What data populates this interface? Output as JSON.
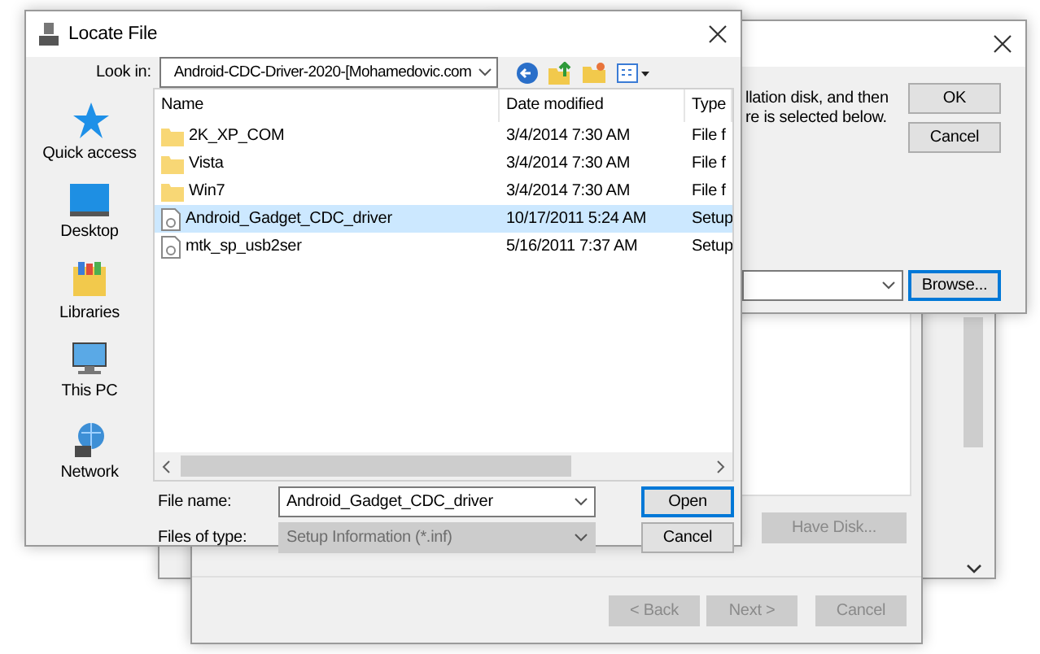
{
  "locate_dialog": {
    "title": "Locate File",
    "look_in_label": "Look in:",
    "look_in_value": "Android-CDC-Driver-2020-[Mohamedovic.com",
    "places": [
      {
        "label": "Quick access",
        "kind": "star"
      },
      {
        "label": "Desktop",
        "kind": "desktop"
      },
      {
        "label": "Libraries",
        "kind": "libraries"
      },
      {
        "label": "This PC",
        "kind": "pc"
      },
      {
        "label": "Network",
        "kind": "network"
      }
    ],
    "columns": [
      "Name",
      "Date modified",
      "Type"
    ],
    "rows": [
      {
        "name": "2K_XP_COM",
        "date": "3/4/2014 7:30 AM",
        "type": "File f",
        "kind": "folder",
        "selected": false
      },
      {
        "name": "Vista",
        "date": "3/4/2014 7:30 AM",
        "type": "File f",
        "kind": "folder",
        "selected": false
      },
      {
        "name": "Win7",
        "date": "3/4/2014 7:30 AM",
        "type": "File f",
        "kind": "folder",
        "selected": false
      },
      {
        "name": "Android_Gadget_CDC_driver",
        "date": "10/17/2011 5:24 AM",
        "type": "Setup",
        "kind": "setup",
        "selected": true
      },
      {
        "name": "mtk_sp_usb2ser",
        "date": "5/16/2011 7:37 AM",
        "type": "Setup",
        "kind": "setup",
        "selected": false
      }
    ],
    "file_name_label": "File name:",
    "file_name_value": "Android_Gadget_CDC_driver",
    "file_type_label": "Files of type:",
    "file_type_value": "Setup Information (*.inf)",
    "file_type_disabled": true,
    "buttons": [
      {
        "label": "Open",
        "default": true
      },
      {
        "label": "Cancel",
        "default": false
      }
    ]
  },
  "install_dialog": {
    "text_lines": [
      "llation disk, and then",
      "re is selected below."
    ],
    "buttons": [
      {
        "label": "OK",
        "default": false
      },
      {
        "label": "Cancel",
        "default": false
      }
    ],
    "browse_button": {
      "label": "Browse...",
      "default": true
    }
  },
  "wizard": {
    "have_disk_button": {
      "label": "Have Disk...",
      "disabled": true
    },
    "footer_buttons": [
      {
        "label": "< Back",
        "disabled": true
      },
      {
        "label": "Next >",
        "disabled": true
      },
      {
        "label": "Cancel",
        "disabled": true
      }
    ]
  }
}
